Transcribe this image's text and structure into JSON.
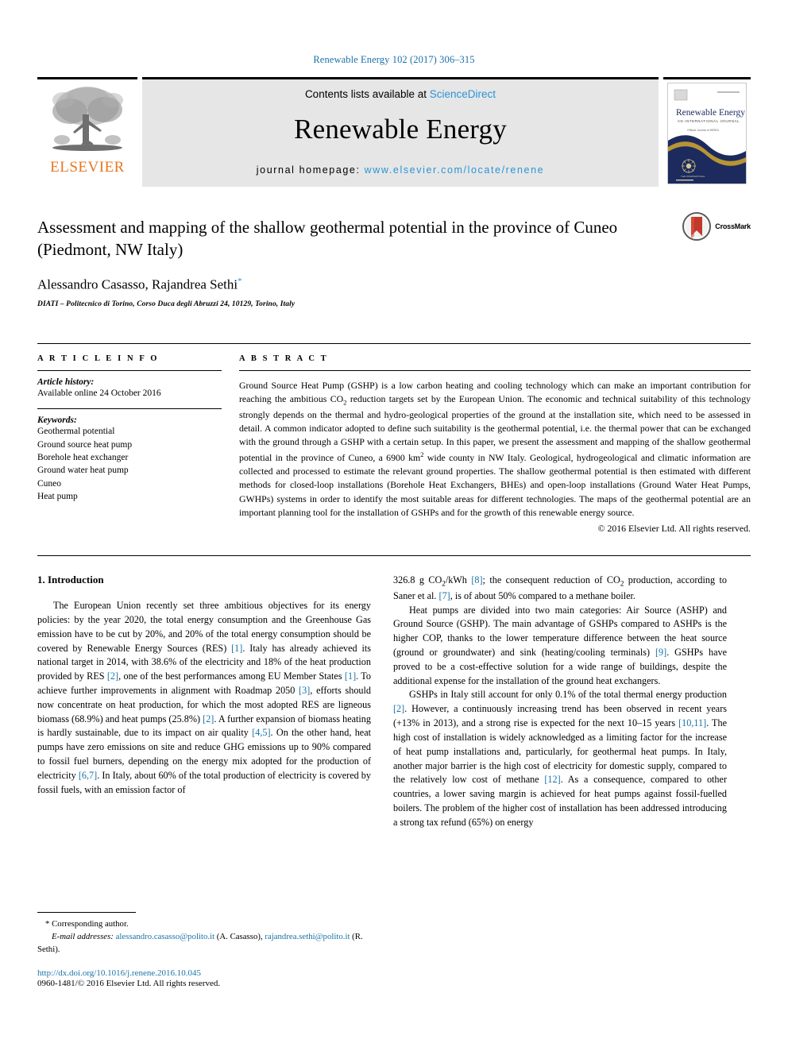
{
  "running_head": "Renewable Energy 102 (2017) 306–315",
  "masthead": {
    "publisher_name": "ELSEVIER",
    "contents_prefix": "Contents lists available at ",
    "contents_link": "ScienceDirect",
    "journal_title": "Renewable Energy",
    "homepage_label": "journal homepage: ",
    "homepage_url": "www.elsevier.com/locate/renene",
    "cover_title": "Renewable Energy",
    "cover_subtitle": "AN INTERNATIONAL JOURNAL",
    "cover_tagline": "Official Journal of WREN / Science Bridging Nations"
  },
  "article": {
    "title": "Assessment and mapping of the shallow geothermal potential in the province of Cuneo (Piedmont, NW Italy)",
    "authors": "Alessandro Casasso, Rajandrea Sethi",
    "corresponding_marker": "*",
    "affiliation": "DIATI – Politecnico di Torino, Corso Duca degli Abruzzi 24, 10129, Torino, Italy",
    "crossmark_label": "CrossMark"
  },
  "article_info": {
    "heading": "A R T I C L E    I N F O",
    "history_label": "Article history:",
    "history_value": "Available online 24 October 2016",
    "keywords_label": "Keywords:",
    "keywords": [
      "Geothermal potential",
      "Ground source heat pump",
      "Borehole heat exchanger",
      "Ground water heat pump",
      "Cuneo",
      "Heat pump"
    ]
  },
  "abstract": {
    "heading": "A B S T R A C T",
    "text_part1": "Ground Source Heat Pump (GSHP) is a low carbon heating and cooling technology which can make an important contribution for reaching the ambitious CO",
    "co2_sub": "2",
    "text_part2": " reduction targets set by the European Union. The economic and technical suitability of this technology strongly depends on the thermal and hydro-geological properties of the ground at the installation site, which need to be assessed in detail. A common indicator adopted to define such suitability is the geothermal potential, i.e. the thermal power that can be exchanged with the ground through a GSHP with a certain setup. In this paper, we present the assessment and mapping of the shallow geothermal potential in the province of Cuneo, a 6900 km",
    "km_sup": "2",
    "text_part3": " wide county in NW Italy. Geological, hydrogeological and climatic information are collected and processed to estimate the relevant ground properties. The shallow geothermal potential is then estimated with different methods for closed-loop installations (Borehole Heat Exchangers, BHEs) and open-loop installations (Ground Water Heat Pumps, GWHPs) systems in order to identify the most suitable areas for different technologies. The maps of the geothermal potential are an important planning tool for the installation of GSHPs and for the growth of this renewable energy source.",
    "copyright": "© 2016 Elsevier Ltd. All rights reserved."
  },
  "introduction": {
    "section_title": "1. Introduction",
    "left_p1_a": "The European Union recently set three ambitious objectives for its energy policies: by the year 2020, the total energy consumption and the Greenhouse Gas emission have to be cut by 20%, and 20% of the total energy consumption should be covered by Renewable Energy Sources (RES) ",
    "cit1": "[1]",
    "left_p1_b": ". Italy has already achieved its national target in 2014, with 38.6% of the electricity and 18% of the heat production provided by RES ",
    "cit2": "[2]",
    "left_p1_c": ", one of the best performances among EU Member States ",
    "cit1b": "[1]",
    "left_p1_d": ". To achieve further improvements in alignment with Roadmap 2050 ",
    "cit3": "[3]",
    "left_p1_e": ", efforts should now concentrate on heat production, for which the most adopted RES are ligneous biomass (68.9%) and heat pumps (25.8%) ",
    "cit2b": "[2]",
    "left_p1_f": ". A further expansion of biomass heating is hardly sustainable, due to its impact on air quality ",
    "cit45": "[4,5]",
    "left_p1_g": ". On the other hand, heat pumps have zero emissions on site and reduce GHG emissions up to 90% compared to fossil fuel burners, depending on the energy mix adopted for the production of electricity ",
    "cit67": "[6,7]",
    "left_p1_h": ". In Italy, about 60% of the total production of electricity is covered by fossil fuels, with an emission factor of",
    "right_p1_a": "326.8 g CO",
    "right_co2_sub": "2",
    "right_p1_b": "/kWh ",
    "cit8": "[8]",
    "right_p1_c": "; the consequent reduction of CO",
    "right_co2_sub2": "2",
    "right_p1_d": " production, according to Saner et al. ",
    "cit7": "[7]",
    "right_p1_e": ", is of about 50% compared to a methane boiler.",
    "right_p2_a": "Heat pumps are divided into two main categories: Air Source (ASHP) and Ground Source (GSHP). The main advantage of GSHPs compared to ASHPs is the higher COP, thanks to the lower temperature difference between the heat source (ground or groundwater) and sink (heating/cooling terminals) ",
    "cit9": "[9]",
    "right_p2_b": ". GSHPs have proved to be a cost-effective solution for a wide range of buildings, despite the additional expense for the installation of the ground heat exchangers.",
    "right_p3_a": "GSHPs in Italy still account for only 0.1% of the total thermal energy production ",
    "cit2c": "[2]",
    "right_p3_b": ". However, a continuously increasing trend has been observed in recent years (+13% in 2013), and a strong rise is expected for the next 10–15 years ",
    "cit1011": "[10,11]",
    "right_p3_c": ". The high cost of installation is widely acknowledged as a limiting factor for the increase of heat pump installations and, particularly, for geothermal heat pumps. In Italy, another major barrier is the high cost of electricity for domestic supply, compared to the relatively low cost of methane ",
    "cit12": "[12]",
    "right_p3_d": ". As a consequence, compared to other countries, a lower saving margin is achieved for heat pumps against fossil-fuelled boilers. The problem of the higher cost of installation has been addressed introducing a strong tax refund (65%) on energy"
  },
  "footnotes": {
    "corresponding": "* Corresponding author.",
    "email_label": "E-mail addresses:",
    "email1": "alessandro.casasso@polito.it",
    "email1_name": " (A. Casasso), ",
    "email2": "rajandrea.sethi@polito.it",
    "email2_name": " (R. Sethi).",
    "doi": "http://dx.doi.org/10.1016/j.renene.2016.10.045",
    "issn": "0960-1481/© 2016 Elsevier Ltd. All rights reserved."
  },
  "colors": {
    "link_blue": "#1a72a8",
    "sciencedirect_blue": "#2a94d6",
    "elsevier_orange": "#E87722",
    "cover_navy": "#1c2a5e",
    "cover_gold": "#d4a72c",
    "crossmark_red": "#c0392b"
  }
}
